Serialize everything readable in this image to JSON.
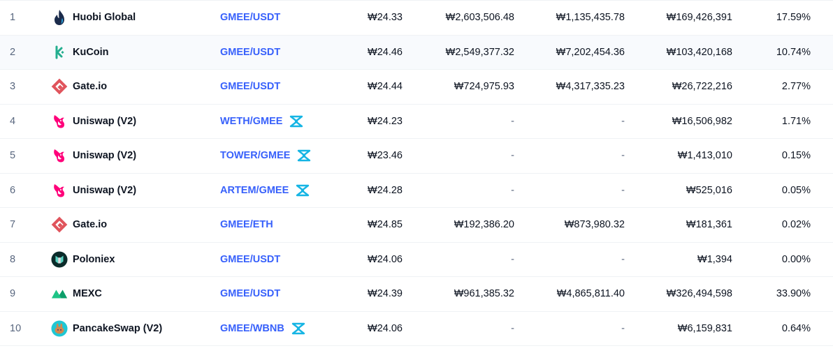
{
  "rows": [
    {
      "rank": "1",
      "exchange": "Huobi Global",
      "logo": "huobi-logo",
      "pair": "GMEE/USDT",
      "dex": false,
      "price": "₩24.33",
      "depth_plus": "₩2,603,506.48",
      "depth_minus": "₩1,135,435.78",
      "volume": "₩169,426,391",
      "share": "17.59%"
    },
    {
      "rank": "2",
      "exchange": "KuCoin",
      "logo": "kucoin-logo",
      "pair": "GMEE/USDT",
      "dex": false,
      "price": "₩24.46",
      "depth_plus": "₩2,549,377.32",
      "depth_minus": "₩7,202,454.36",
      "volume": "₩103,420,168",
      "share": "10.74%"
    },
    {
      "rank": "3",
      "exchange": "Gate.io",
      "logo": "gateio-logo",
      "pair": "GMEE/USDT",
      "dex": false,
      "price": "₩24.44",
      "depth_plus": "₩724,975.93",
      "depth_minus": "₩4,317,335.23",
      "volume": "₩26,722,216",
      "share": "2.77%"
    },
    {
      "rank": "4",
      "exchange": "Uniswap (V2)",
      "logo": "uniswap-logo",
      "pair": "WETH/GMEE",
      "dex": true,
      "price": "₩24.23",
      "depth_plus": "-",
      "depth_minus": "-",
      "volume": "₩16,506,982",
      "share": "1.71%"
    },
    {
      "rank": "5",
      "exchange": "Uniswap (V2)",
      "logo": "uniswap-logo",
      "pair": "TOWER/GMEE",
      "dex": true,
      "price": "₩23.46",
      "depth_plus": "-",
      "depth_minus": "-",
      "volume": "₩1,413,010",
      "share": "0.15%"
    },
    {
      "rank": "6",
      "exchange": "Uniswap (V2)",
      "logo": "uniswap-logo",
      "pair": "ARTEM/GMEE",
      "dex": true,
      "price": "₩24.28",
      "depth_plus": "-",
      "depth_minus": "-",
      "volume": "₩525,016",
      "share": "0.05%"
    },
    {
      "rank": "7",
      "exchange": "Gate.io",
      "logo": "gateio-logo",
      "pair": "GMEE/ETH",
      "dex": false,
      "price": "₩24.85",
      "depth_plus": "₩192,386.20",
      "depth_minus": "₩873,980.32",
      "volume": "₩181,361",
      "share": "0.02%"
    },
    {
      "rank": "8",
      "exchange": "Poloniex",
      "logo": "poloniex-logo",
      "pair": "GMEE/USDT",
      "dex": false,
      "price": "₩24.06",
      "depth_plus": "-",
      "depth_minus": "-",
      "volume": "₩1,394",
      "share": "0.00%"
    },
    {
      "rank": "9",
      "exchange": "MEXC",
      "logo": "mexc-logo",
      "pair": "GMEE/USDT",
      "dex": false,
      "price": "₩24.39",
      "depth_plus": "₩961,385.32",
      "depth_minus": "₩4,865,811.40",
      "volume": "₩326,494,598",
      "share": "33.90%"
    },
    {
      "rank": "10",
      "exchange": "PancakeSwap (V2)",
      "logo": "pancakeswap-logo",
      "pair": "GMEE/WBNB",
      "dex": true,
      "price": "₩24.06",
      "depth_plus": "-",
      "depth_minus": "-",
      "volume": "₩6,159,831",
      "share": "0.64%"
    }
  ],
  "colors": {
    "link": "#3861fb",
    "muted": "#58667e",
    "dex_icon": "#16b5e4"
  }
}
